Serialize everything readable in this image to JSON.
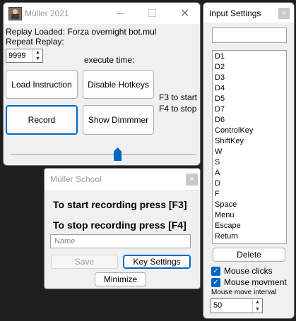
{
  "main": {
    "title": "Müller 2021",
    "replay_loaded": "Replay Loaded: Forza overnight bot.mul",
    "repeat_replay": "Repeat Replay:",
    "repeat_value": "9999",
    "execute_time": "execute time:",
    "load_instruction": "Load Instruction",
    "disable_hotkeys": "Disable Hotkeys",
    "record": "Record",
    "show_dimmer": "Show Dimmmer",
    "hint_start": "F3 to start",
    "hint_stop": "F4 to stop",
    "slider_level": 0.58
  },
  "school": {
    "title": "Müller School",
    "line_start": "To start recording press [F3]",
    "line_stop": "To stop recording press [F4]",
    "name_placeholder": "Name",
    "save": "Save",
    "key_settings": "Key Settings",
    "minimize": "Minimize"
  },
  "input_settings": {
    "title": "Input Settings",
    "close": "×",
    "search_value": "",
    "keys": [
      "D1",
      "D2",
      "D3",
      "D4",
      "D5",
      "D7",
      "D6",
      "ControlKey",
      "ShiftKey",
      "W",
      "S",
      "A",
      "D",
      "F",
      "Space",
      "Menu",
      "Escape",
      "Return"
    ],
    "delete": "Delete",
    "mouse_clicks": "Mouse clicks",
    "mouse_movement": "Mouse movment",
    "mouse_move_interval": "Mouse move interval",
    "interval_value": "50"
  },
  "colors": {
    "accent": "#0067c0",
    "close_red": "#e81123"
  }
}
